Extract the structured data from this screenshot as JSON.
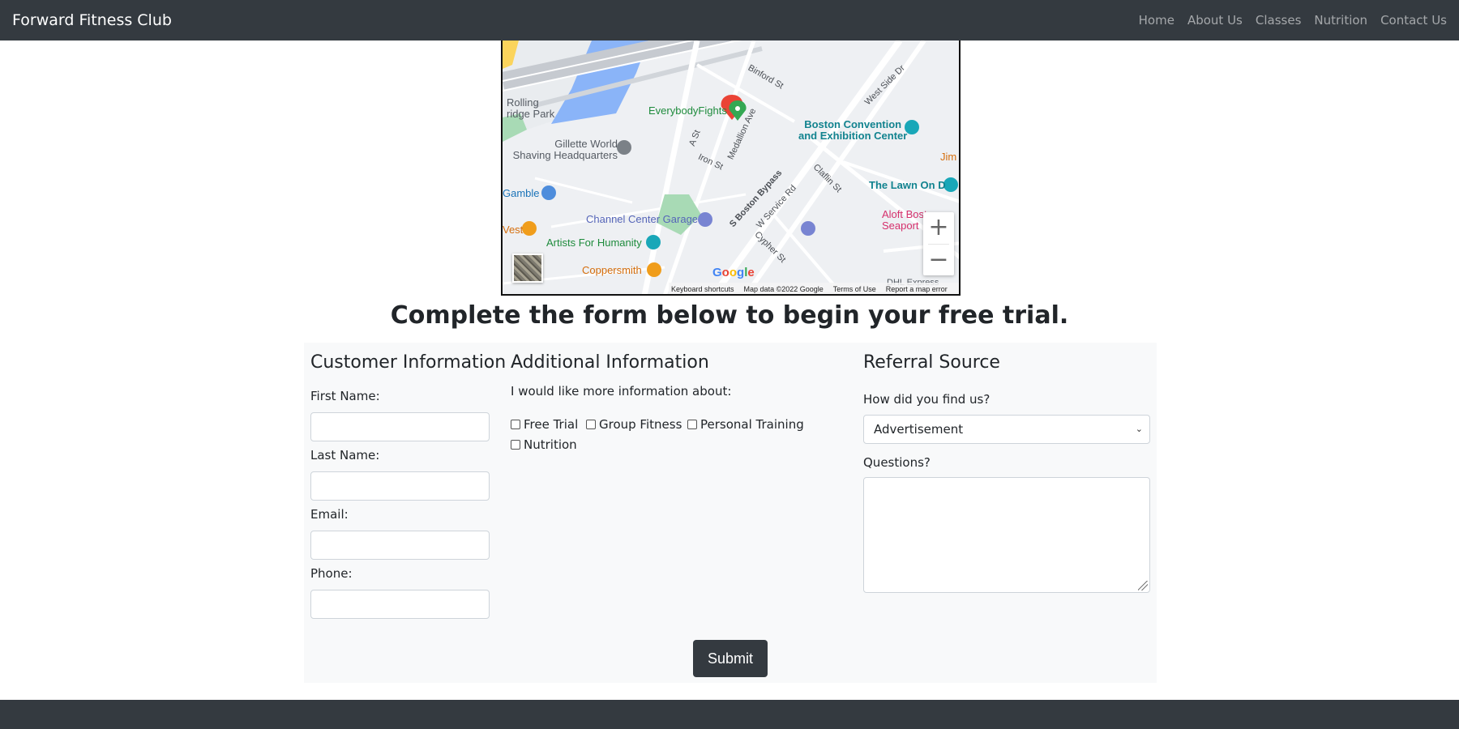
{
  "navbar": {
    "brand": "Forward Fitness Club",
    "links": [
      "Home",
      "About Us",
      "Classes",
      "Nutrition",
      "Contact Us"
    ]
  },
  "map": {
    "places": {
      "rolling_bridge_park": "Rolling\nridge Park",
      "everybodyfights": "EverybodyFights",
      "gillette": "Gillette World\nShaving Headquarters",
      "boston_convention": "Boston Convention\nand Exhibition Center",
      "gamble": "Gamble",
      "channel_center_garage": "Channel Center Garage",
      "artists_for_humanity": "Artists For Humanity",
      "coppersmith": "Coppersmith",
      "west": "Vest",
      "the_lawn": "The Lawn On D",
      "aloft": "Aloft Boston\nSeaport",
      "jimmy": "Jim",
      "dhl": "DHL Express"
    },
    "streets": {
      "binford": "Binford St",
      "a_st": "A St",
      "iron": "Iron St",
      "medallion": "Medallion Ave",
      "s_boston_bypass": "S Boston Bypass",
      "w_service": "W Service Rd",
      "claflin": "Claflin St",
      "cypher": "Cypher St",
      "west_side_dr": "West Side Dr"
    },
    "google_logo": "Google",
    "attribution": {
      "shortcuts": "Keyboard shortcuts",
      "map_data": "Map data ©2022 Google",
      "terms": "Terms of Use",
      "report": "Report a map error"
    },
    "zoom_in": "+",
    "zoom_out": "−"
  },
  "headline": "Complete the form below to begin your free trial.",
  "form": {
    "customer": {
      "heading": "Customer Information",
      "first_name_label": "First Name:",
      "last_name_label": "Last Name:",
      "email_label": "Email:",
      "phone_label": "Phone:",
      "first_name_value": "",
      "last_name_value": "",
      "email_value": "",
      "phone_value": ""
    },
    "additional": {
      "heading": "Additional Information",
      "prompt": "I would like more information about:",
      "options": [
        "Free Trial",
        "Group Fitness",
        "Personal Training",
        "Nutrition"
      ]
    },
    "referral": {
      "heading": "Referral Source",
      "how_label": "How did you find us?",
      "how_selected": "Advertisement",
      "questions_label": "Questions?",
      "questions_value": ""
    },
    "submit_label": "Submit"
  },
  "colors": {
    "navbar_bg": "#343a40",
    "form_bg": "#f8f9fa"
  }
}
